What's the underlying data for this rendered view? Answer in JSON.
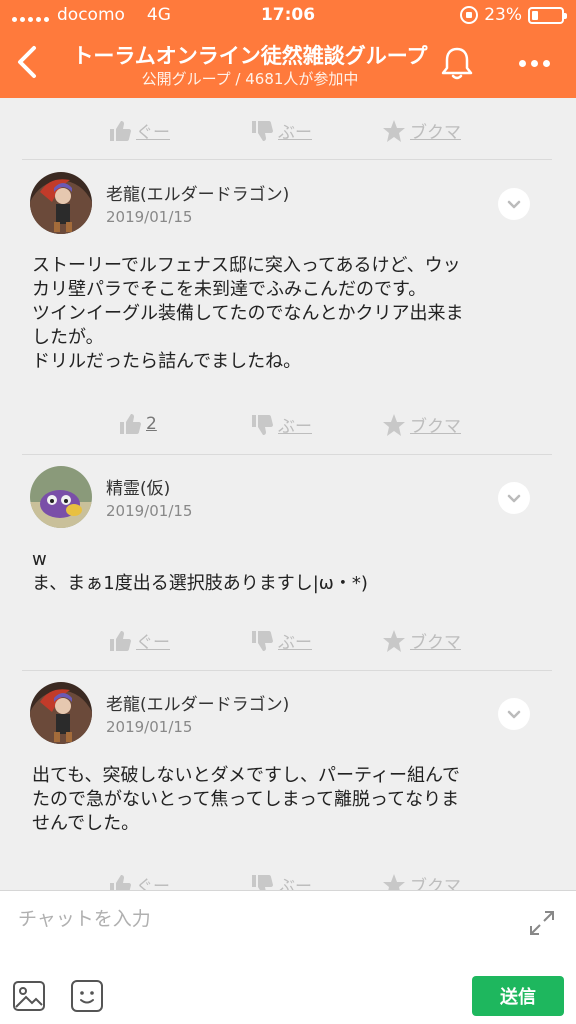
{
  "status_bar": {
    "carrier": "docomo",
    "network": "4G",
    "time": "17:06",
    "battery": "23%"
  },
  "header": {
    "title": "トーラムオンライン徒然雑談グループ",
    "subtitle": "公開グループ / 4681人が参加中"
  },
  "reactions": {
    "good": "ぐー",
    "boo": "ぶー",
    "bookmark": "ブクマ"
  },
  "posts": [
    {
      "author": "老龍(エルダードラゴン)",
      "date": "2019/01/15",
      "lines": [
        "ストーリーでルフェナス邸に突入ってあるけど、ウッ",
        "カリ壁パラでそこを未到達でふみこんだのです。",
        "ツインイーグル装備してたのでなんとかクリア出来ま",
        "したが。",
        "ドリルだったら詰んでましたね。"
      ],
      "good_count": "2"
    },
    {
      "author": "精霊(仮)",
      "date": "2019/01/15",
      "lines": [
        "w",
        "ま、まぁ1度出る選択肢ありますし|ω・*)"
      ]
    },
    {
      "author": "老龍(エルダードラゴン)",
      "date": "2019/01/15",
      "lines": [
        "出ても、突破しないとダメですし、パーティー組んで",
        "たので急がないとって焦ってしまって離脱ってなりま",
        "せんでした。"
      ]
    }
  ],
  "composer": {
    "placeholder": "チャットを入力",
    "send_label": "送信"
  },
  "colors": {
    "header_bg": "#ff7a3c",
    "send_bg": "#1eb75e"
  }
}
